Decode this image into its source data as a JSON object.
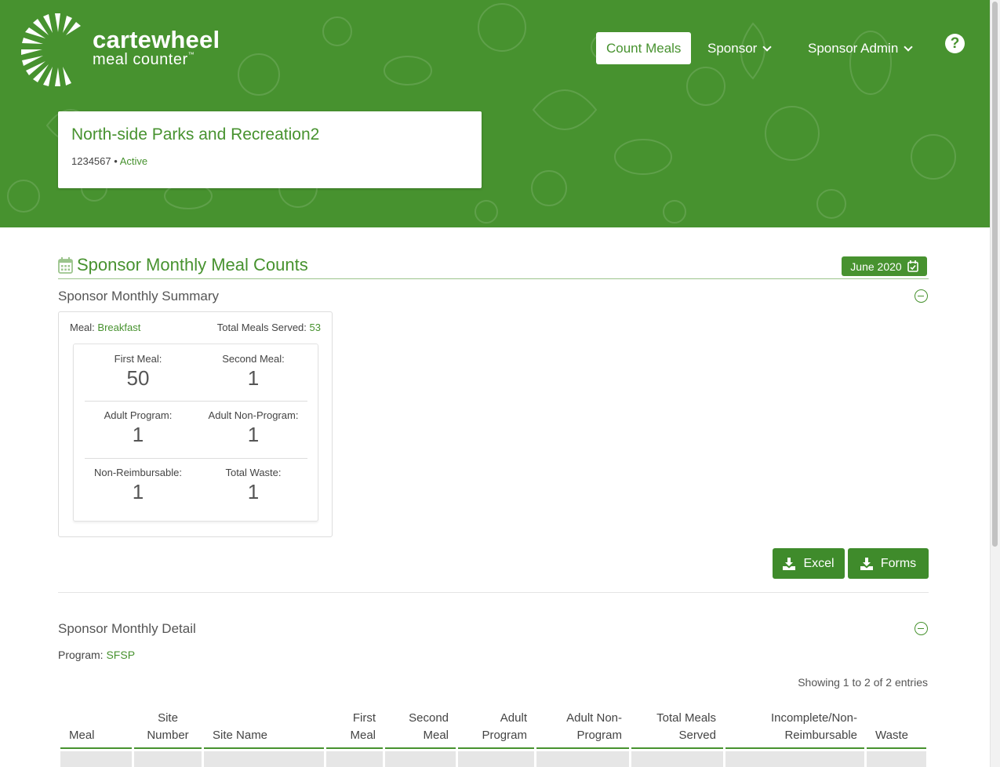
{
  "brand": {
    "name_line1": "cartewheel",
    "name_line2": "meal counter",
    "trademark": "™",
    "color": "#47922f"
  },
  "nav": {
    "count_meals": "Count Meals",
    "sponsor": "Sponsor",
    "sponsor_admin": "Sponsor Admin",
    "help": "?"
  },
  "org": {
    "name": "North-side Parks and Recreation2",
    "id": "1234567",
    "separator": "•",
    "status": "Active"
  },
  "page": {
    "title": "Sponsor Monthly Meal Counts",
    "month": "June 2020"
  },
  "summary": {
    "heading": "Sponsor Monthly Summary",
    "meal_label": "Meal:",
    "meal_value": "Breakfast",
    "total_label": "Total Meals Served:",
    "total_value": "53",
    "stats": [
      {
        "label": "First Meal:",
        "value": "50"
      },
      {
        "label": "Second Meal:",
        "value": "1"
      },
      {
        "label": "Adult Program:",
        "value": "1"
      },
      {
        "label": "Adult Non-Program:",
        "value": "1"
      },
      {
        "label": "Non-Reimbursable:",
        "value": "1"
      },
      {
        "label": "Total Waste:",
        "value": "1"
      }
    ]
  },
  "exports": {
    "excel": "Excel",
    "forms": "Forms"
  },
  "detail": {
    "heading": "Sponsor Monthly Detail",
    "program_label": "Program:",
    "program_value": "SFSP",
    "showing": "Showing 1 to 2 of 2 entries",
    "columns": [
      {
        "line1": "Meal",
        "line2": ""
      },
      {
        "line1": "Site",
        "line2": "Number"
      },
      {
        "line1": "Site Name",
        "line2": ""
      },
      {
        "line1": "First",
        "line2": "Meal"
      },
      {
        "line1": "Second",
        "line2": "Meal"
      },
      {
        "line1": "Adult",
        "line2": "Program"
      },
      {
        "line1": "Adult Non-",
        "line2": "Program"
      },
      {
        "line1": "Total Meals",
        "line2": "Served"
      },
      {
        "line1": "Incomplete/Non-",
        "line2": "Reimbursable"
      },
      {
        "line1": "Waste",
        "line2": ""
      }
    ]
  }
}
